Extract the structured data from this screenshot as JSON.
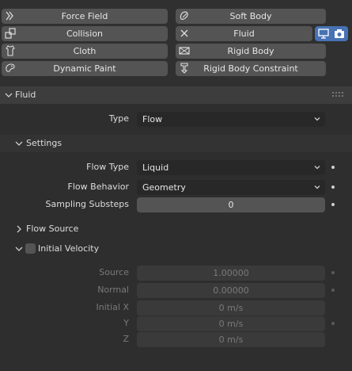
{
  "physics_buttons": {
    "force_field": "Force Field",
    "soft_body": "Soft Body",
    "collision": "Collision",
    "fluid": "Fluid",
    "cloth": "Cloth",
    "rigid_body": "Rigid Body",
    "dynamic_paint": "Dynamic Paint",
    "rigid_body_constraint": "Rigid Body Constraint"
  },
  "fluid_panel": {
    "title": "Fluid",
    "type_label": "Type",
    "type_value": "Flow",
    "settings": {
      "title": "Settings",
      "flow_type_label": "Flow Type",
      "flow_type_value": "Liquid",
      "flow_behavior_label": "Flow Behavior",
      "flow_behavior_value": "Geometry",
      "sampling_substeps_label": "Sampling Substeps",
      "sampling_substeps_value": "0"
    },
    "flow_source": {
      "title": "Flow Source"
    },
    "initial_velocity": {
      "title": "Initial Velocity",
      "enabled": false,
      "source_label": "Source",
      "source_value": "1.00000",
      "normal_label": "Normal",
      "normal_value": "0.00000",
      "initial_x_label": "Initial X",
      "initial_x_value": "0 m/s",
      "y_label": "Y",
      "y_value": "0 m/s",
      "z_label": "Z",
      "z_value": "0 m/s"
    }
  },
  "colors": {
    "background": "#303030",
    "button": "#545454",
    "field_dark": "#282828",
    "accent_blue": "#4772b3"
  }
}
